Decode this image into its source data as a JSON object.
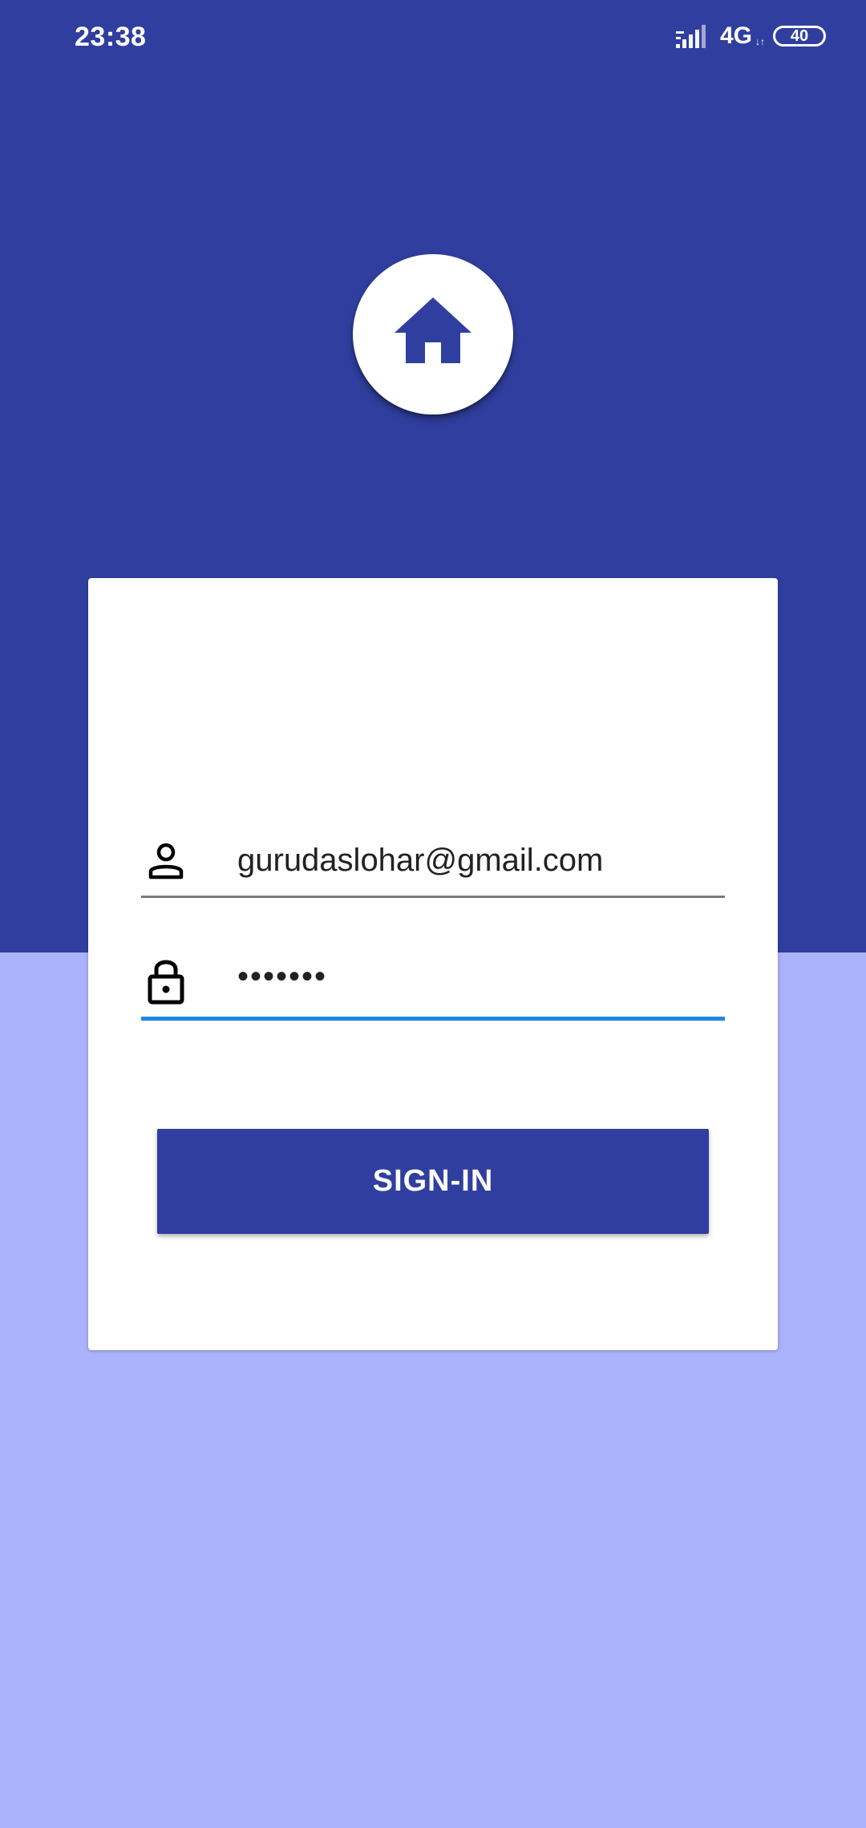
{
  "status_bar": {
    "time": "23:38",
    "network_type": "4G",
    "network_arrows": "↓↑",
    "battery_level": "40",
    "icons": [
      "signal-icon",
      "battery-icon"
    ]
  },
  "logo": {
    "icon": "home-icon"
  },
  "login_form": {
    "email": {
      "icon": "person-icon",
      "value": "gurudaslohar@gmail.com"
    },
    "password": {
      "icon": "lock-icon",
      "value": "•••••••"
    },
    "signin_label": "SIGN-IN"
  },
  "colors": {
    "primary": "#303f9f",
    "background_lower": "#abb3fb",
    "focus_underline": "#1e88e5",
    "card": "#ffffff"
  }
}
